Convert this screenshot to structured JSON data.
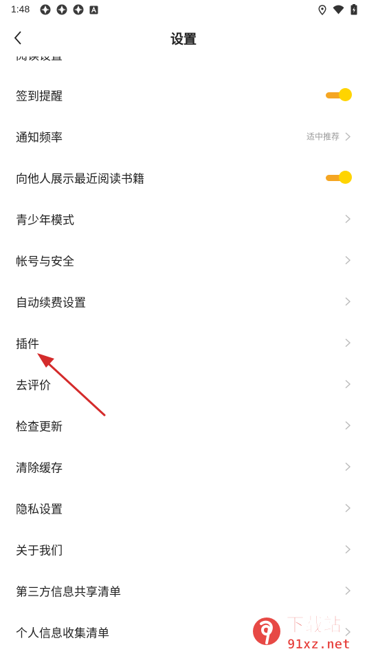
{
  "status_bar": {
    "time": "1:48",
    "left_icons": [
      "app-notification-icon",
      "app-notification-icon",
      "app-notification-icon",
      "a-icon"
    ],
    "right_icons": [
      "location-icon",
      "wifi-icon",
      "battery-icon"
    ]
  },
  "header": {
    "title": "设置",
    "back_icon": "chevron-left-icon"
  },
  "settings": {
    "partial_item": {
      "label": "阅读设置"
    },
    "items": [
      {
        "label": "签到提醒",
        "control": "toggle",
        "on": true
      },
      {
        "label": "通知频率",
        "control": "value",
        "value": "适中推荐"
      },
      {
        "label": "向他人展示最近阅读书籍",
        "control": "toggle",
        "on": true
      },
      {
        "label": "青少年模式",
        "control": "chevron"
      },
      {
        "label": "帐号与安全",
        "control": "chevron"
      },
      {
        "label": "自动续费设置",
        "control": "chevron"
      },
      {
        "label": "插件",
        "control": "chevron"
      },
      {
        "label": "去评价",
        "control": "chevron"
      },
      {
        "label": "检查更新",
        "control": "chevron"
      },
      {
        "label": "清除缓存",
        "control": "chevron"
      },
      {
        "label": "隐私设置",
        "control": "chevron"
      },
      {
        "label": "关于我们",
        "control": "chevron"
      },
      {
        "label": "第三方信息共享清单",
        "control": "chevron"
      },
      {
        "label": "个人信息收集清单",
        "control": "chevron"
      }
    ]
  },
  "annotation": {
    "arrow_color": "#d42b2b"
  },
  "watermark": {
    "brand_text": "下载站",
    "domain_text": "91xz.net",
    "color": "#e53935"
  },
  "colors": {
    "toggle_track": "#f5a623",
    "toggle_knob": "#ffd400",
    "text_primary": "#222222",
    "text_secondary": "#999999"
  }
}
